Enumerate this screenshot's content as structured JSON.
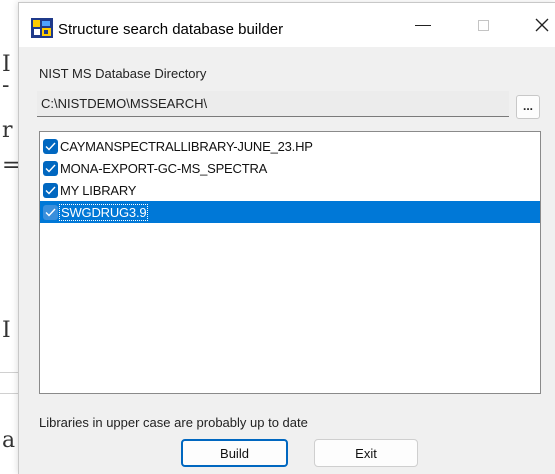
{
  "window": {
    "title": "Structure search database builder"
  },
  "colors": {
    "accent": "#0078d7",
    "checkbox": "#0067c0",
    "window_bg": "#f0f0f0"
  },
  "icons": {
    "app": "app-icon",
    "minimize": "minimize-icon",
    "maximize": "maximize-icon",
    "close": "close-icon",
    "checkbox": "checkmark-icon"
  },
  "directory": {
    "label": "NIST MS Database Directory",
    "value": "C:\\NISTDEMO\\MSSEARCH\\",
    "browse_label": "..."
  },
  "libraries": {
    "items": [
      {
        "label": "CAYMANSPECTRALLIBRARY-JUNE_23.HP",
        "checked": true,
        "selected": false
      },
      {
        "label": "MONA-EXPORT-GC-MS_SPECTRA",
        "checked": true,
        "selected": false
      },
      {
        "label": "MY LIBRARY",
        "checked": true,
        "selected": false
      },
      {
        "label": "SWGDRUG3.9",
        "checked": true,
        "selected": true
      }
    ]
  },
  "hint": "Libraries in upper case are probably up to date",
  "buttons": {
    "build": "Build",
    "exit": "Exit"
  }
}
